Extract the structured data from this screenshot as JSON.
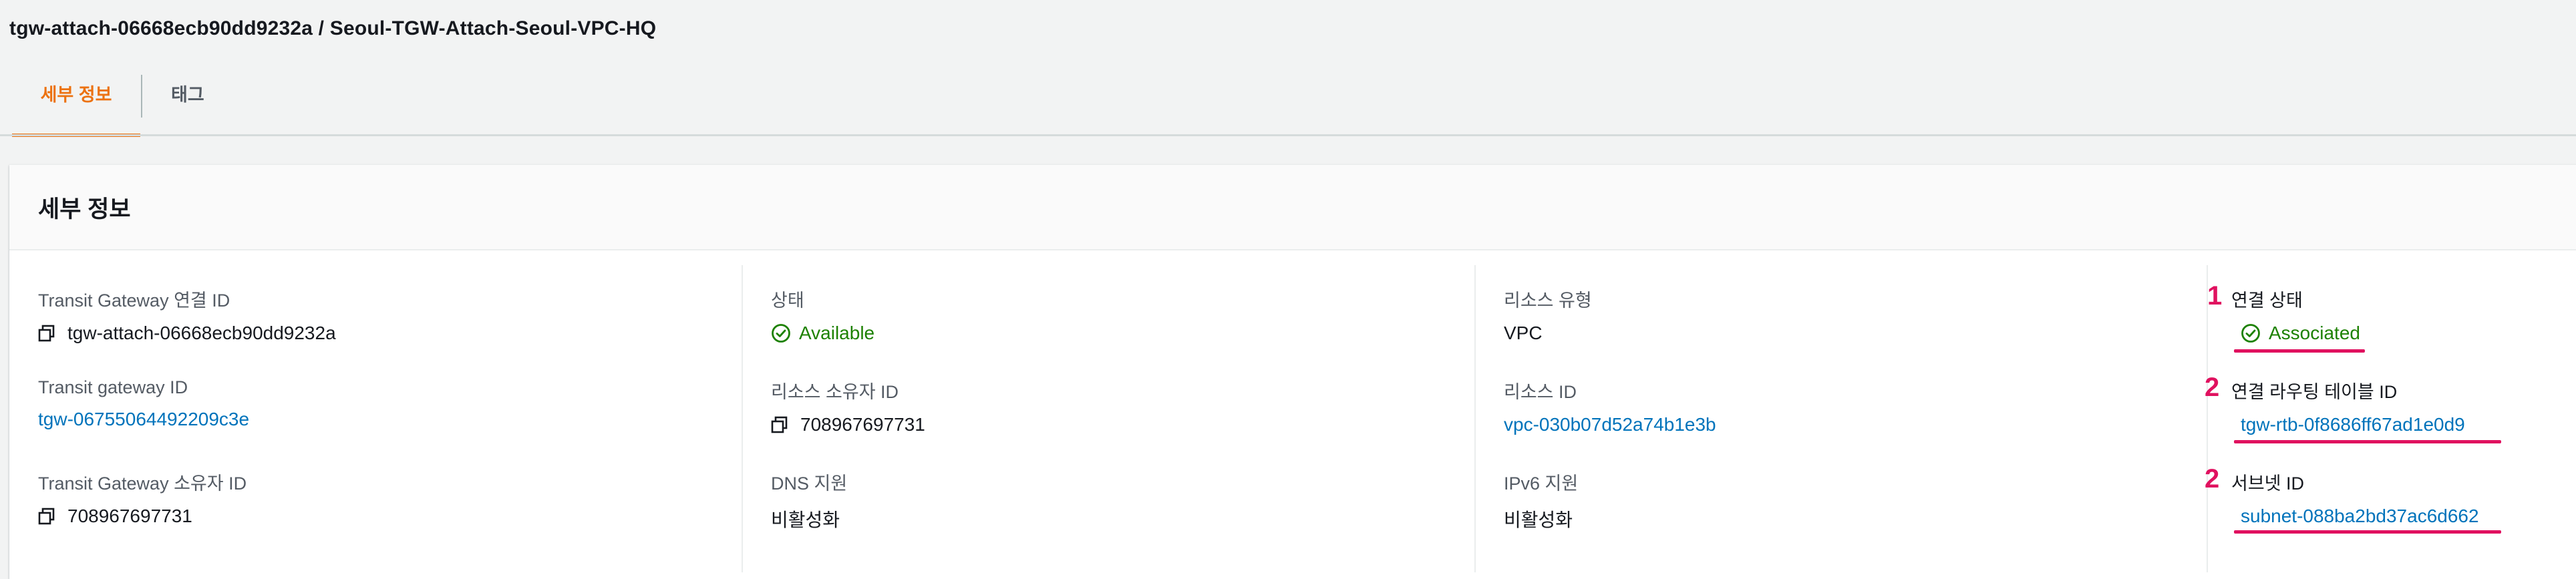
{
  "page": {
    "title": "tgw-attach-06668ecb90dd9232a / Seoul-TGW-Attach-Seoul-VPC-HQ"
  },
  "tabs": [
    {
      "label": "세부 정보",
      "active": true
    },
    {
      "label": "태그",
      "active": false
    }
  ],
  "panel": {
    "title": "세부 정보"
  },
  "details": {
    "col1": {
      "attach_id_label": "Transit Gateway 연결 ID",
      "attach_id_value": "tgw-attach-06668ecb90dd9232a",
      "tgw_id_label": "Transit gateway ID",
      "tgw_id_value": "tgw-06755064492209c3e",
      "tgw_owner_label": "Transit Gateway 소유자 ID",
      "tgw_owner_value": "708967697731"
    },
    "col2": {
      "state_label": "상태",
      "state_value": "Available",
      "resource_owner_label": "리소스 소유자 ID",
      "resource_owner_value": "708967697731",
      "dns_label": "DNS 지원",
      "dns_value": "비활성화"
    },
    "col3": {
      "resource_type_label": "리소스 유형",
      "resource_type_value": "VPC",
      "resource_id_label": "리소스 ID",
      "resource_id_value": "vpc-030b07d52a74b1e3b",
      "ipv6_label": "IPv6 지원",
      "ipv6_value": "비활성화"
    },
    "col4": {
      "assoc_state_label": "연결 상태",
      "assoc_state_value": "Associated",
      "route_table_label": "연결 라우팅 테이블 ID",
      "route_table_value": "tgw-rtb-0f8686ff67ad1e0d9",
      "subnet_label": "서브넷 ID",
      "subnet_value": "subnet-088ba2bd37ac6d662"
    }
  },
  "annotations": {
    "marker1": "1",
    "marker2": "2",
    "marker3": "2",
    "color": "#e0115f"
  },
  "icons": {
    "copy": "copy-icon",
    "status_ok": "check-circle-icon"
  },
  "colors": {
    "accent": "#ec7211",
    "link": "#0073bb",
    "success": "#1d8102"
  }
}
